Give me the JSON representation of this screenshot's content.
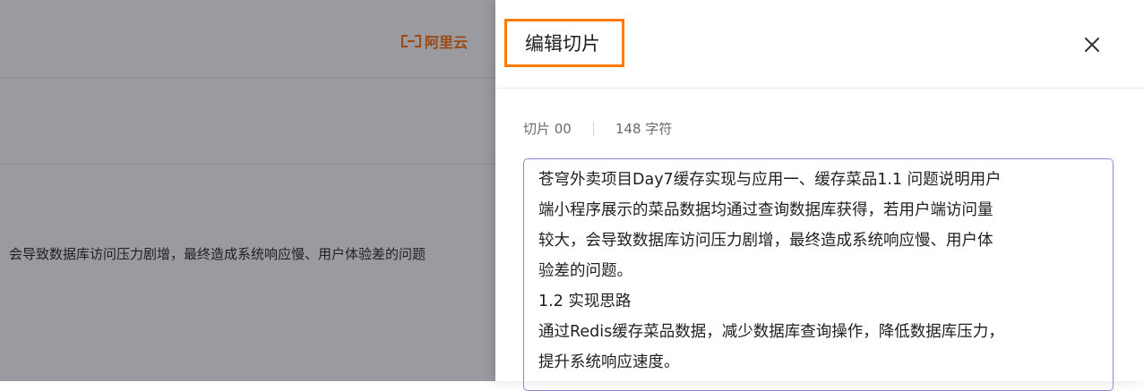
{
  "background": {
    "logo_text": "阿里云",
    "body_text": "会导致数据库访问压力剧增，最终造成系统响应慢、用户体验差的问题"
  },
  "drawer": {
    "title": "编辑切片",
    "close_icon": "close-icon",
    "meta": {
      "slice_label": "切片 00",
      "char_count": "148 字符"
    },
    "content": {
      "lines": [
        "苍穹外卖项目Day7缓存实现与应用一、缓存菜品1.1 问题说明用户",
        "端小程序展示的菜品数据均通过查询数据库获得，若用户端访问量",
        "较大，会导致数据库访问压力剧增，最终造成系统响应慢、用户体",
        "验差的问题。",
        "1.2 实现思路",
        "通过Redis缓存菜品数据，减少数据库查询操作，降低数据库压力，",
        "提升系统响应速度。"
      ]
    }
  },
  "colors": {
    "accent_orange": "#ff7a00",
    "editor_border": "#8b87d8"
  }
}
